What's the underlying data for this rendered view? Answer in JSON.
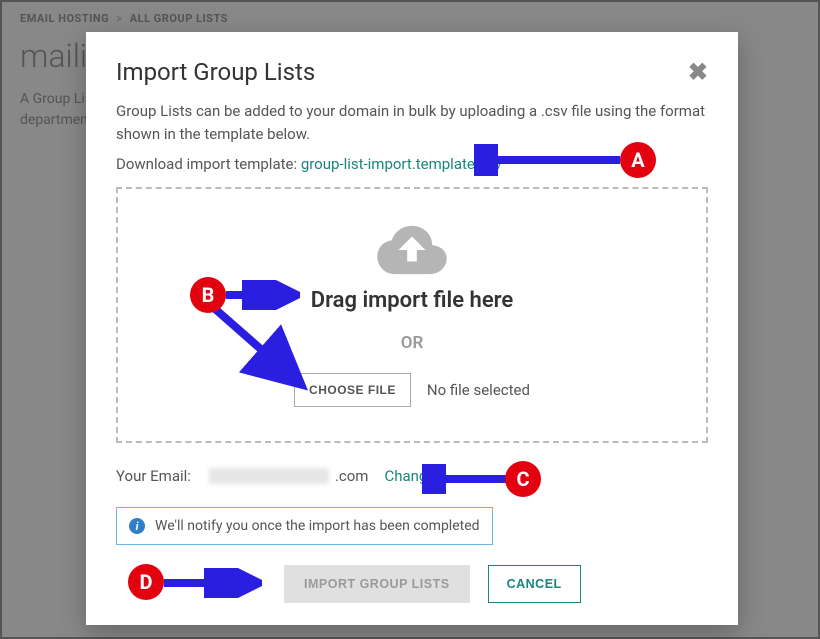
{
  "breadcrumb": {
    "part1": "EMAIL HOSTING",
    "part2": "ALL GROUP LISTS"
  },
  "page": {
    "title": "mailit",
    "desc": "A Group List allows you to email multiple recipients via a single email address. Group lists are commonly used for departments, teams, support lines, or any group of employees."
  },
  "modal": {
    "title": "Import Group Lists",
    "desc": "Group Lists can be added to your domain in bulk by uploading a .csv file using the format shown in the template below.",
    "download_label": "Download import template: ",
    "download_file": "group-list-import.template.csv",
    "drag_text": "Drag import file here",
    "or_text": "OR",
    "choose_btn": "CHOOSE FILE",
    "no_file": "No file selected",
    "email_label": "Your Email:",
    "email_domain": ".com",
    "change_label": "Change",
    "info_text": "We'll notify you once the import has been completed",
    "import_btn": "IMPORT GROUP LISTS",
    "cancel_btn": "CANCEL"
  },
  "markers": {
    "a": "A",
    "b": "B",
    "c": "C",
    "d": "D"
  }
}
